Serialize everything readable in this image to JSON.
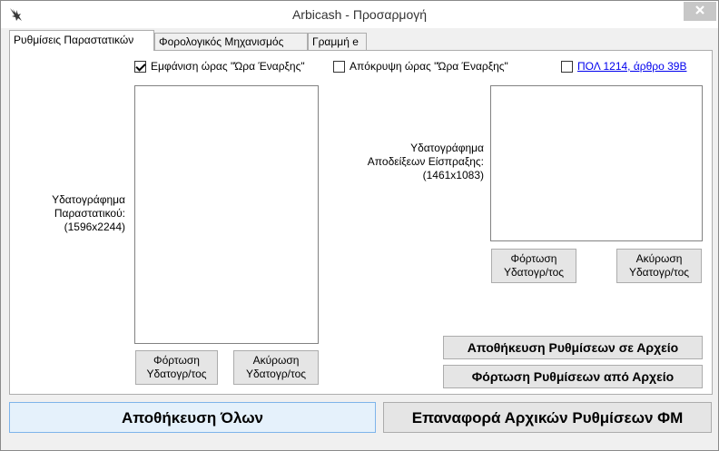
{
  "window": {
    "title": "Arbicash - Προσαρμογή",
    "close_symbol": "×"
  },
  "tabs": [
    {
      "label": "Ρυθμίσεις Παραστατικών",
      "active": true
    },
    {
      "label": "Φορολογικός Μηχανισμός",
      "active": false
    },
    {
      "label": "Γραμμή e",
      "active": false
    }
  ],
  "settings": {
    "show_start_time": {
      "label": "Εμφάνιση ώρας \"Ώρα Έναρξης\"",
      "checked": true
    },
    "hide_start_time": {
      "label": "Απόκρυψη ώρας \"Ώρα Έναρξης\"",
      "checked": false
    },
    "pol_1214": {
      "label": "ΠΟΛ 1214, άρθρο 39Β",
      "checked": false
    }
  },
  "watermark_invoice": {
    "label_line1": "Υδατογράφημα",
    "label_line2": "Παραστατικού:",
    "label_line3": "(1596x2244)",
    "load_line1": "Φόρτωση",
    "load_line2": "Υδατογρ/τος",
    "cancel_line1": "Ακύρωση",
    "cancel_line2": "Υδατογρ/τος"
  },
  "watermark_receipt": {
    "label_line1": "Υδατογράφημα",
    "label_line2": "Αποδείξεων Είσπραξης:",
    "label_line3": "(1461x1083)",
    "load_line1": "Φόρτωση",
    "load_line2": "Υδατογρ/τος",
    "cancel_line1": "Ακύρωση",
    "cancel_line2": "Υδατογρ/τος"
  },
  "file_actions": {
    "save_to_file": "Αποθήκευση Ρυθμίσεων σε Αρχείο",
    "load_from_file": "Φόρτωση Ρυθμίσεων από Αρχείο"
  },
  "footer": {
    "save_all": "Αποθήκευση Όλων",
    "reset_fm": "Επαναφορά Αρχικών Ρυθμίσεων ΦΜ"
  }
}
